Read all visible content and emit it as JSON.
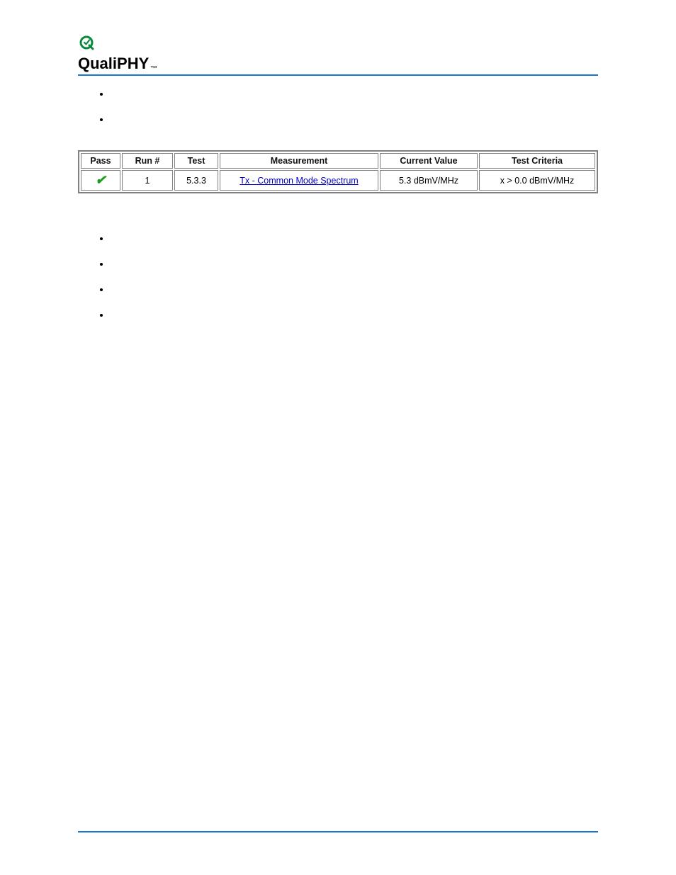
{
  "logo": {
    "brand_html": "QualiPHY",
    "tm": "™"
  },
  "top_bullets": [
    "",
    ""
  ],
  "back_link": "",
  "table": {
    "headers": {
      "pass": "Pass",
      "run": "Run #",
      "test": "Test",
      "measurement": "Measurement",
      "value": "Current Value",
      "criteria": "Test Criteria"
    },
    "rows": [
      {
        "pass": "✔",
        "run": "1",
        "test": "5.3.3",
        "measurement": "Tx - Common Mode Spectrum",
        "value": "5.3 dBmV/MHz",
        "criteria": "x > 0.0 dBmV/MHz"
      }
    ]
  },
  "bottom_bullets": [
    "",
    "",
    "",
    ""
  ]
}
